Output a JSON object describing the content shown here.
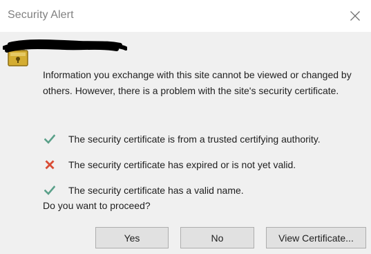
{
  "window": {
    "title": "Security Alert"
  },
  "message": "Information you exchange with this site cannot be viewed or changed by others. However, there is a problem with the site's security certificate.",
  "checks": [
    {
      "status": "ok",
      "icon": "green-check-icon",
      "text": "The security certificate is from a trusted certifying authority."
    },
    {
      "status": "error",
      "icon": "red-x-icon",
      "text": "The security certificate has expired or is not yet valid."
    },
    {
      "status": "ok",
      "icon": "green-check-icon",
      "text": "The security certificate has a valid name."
    }
  ],
  "question": "Do you want to proceed?",
  "buttons": {
    "yes": "Yes",
    "no": "No",
    "view_certificate": "View Certificate..."
  },
  "colors": {
    "check_green": "#5aa089",
    "error_red": "#d94c35",
    "lock_gold": "#c9a227"
  }
}
